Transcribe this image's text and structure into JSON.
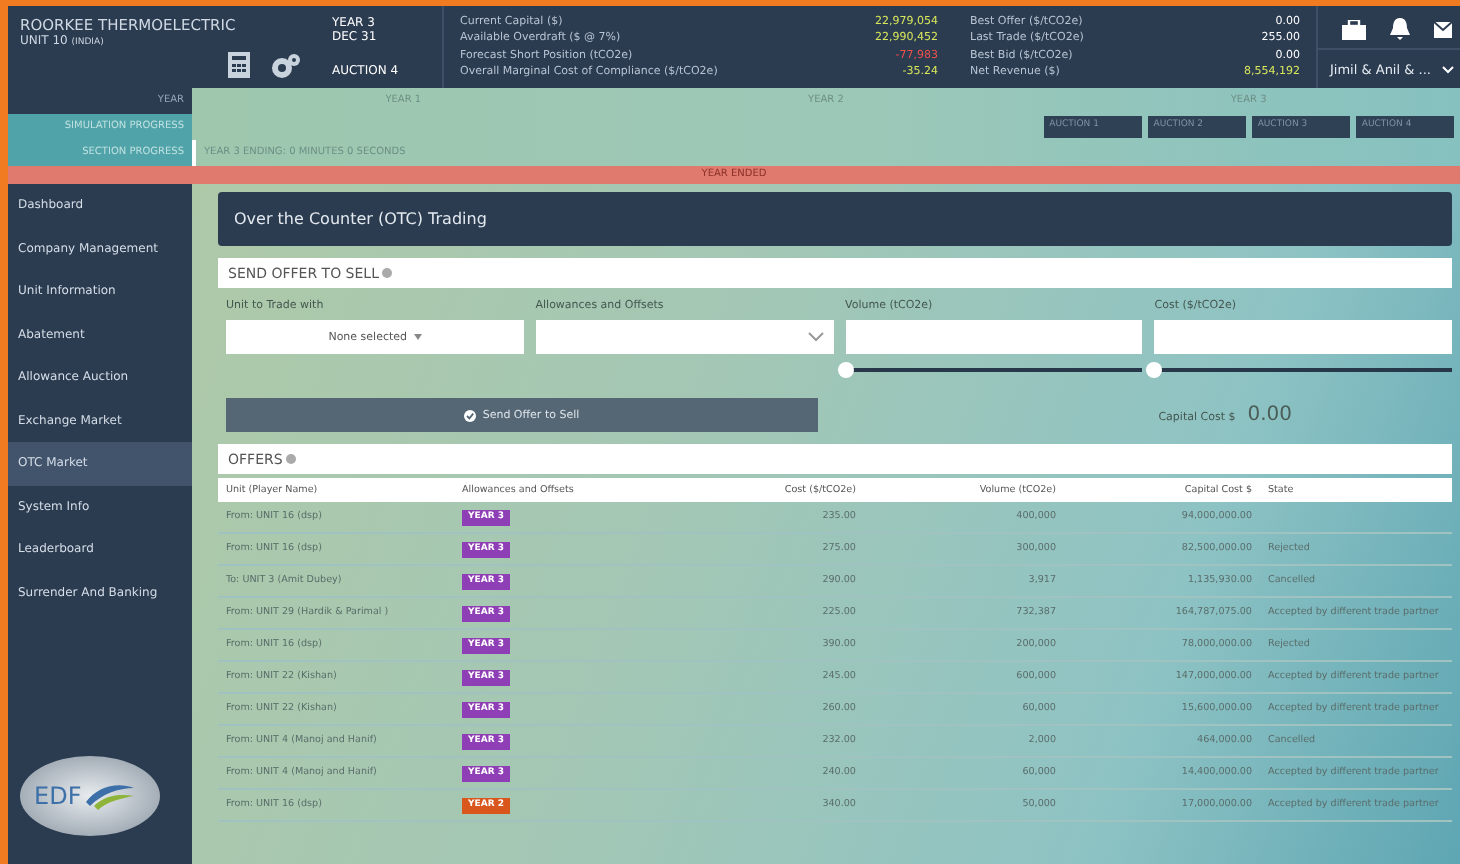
{
  "company": {
    "name": "ROORKEE THERMOELECTRIC",
    "unit": "UNIT 10",
    "region": "(INDIA)"
  },
  "period": {
    "year": "YEAR 3",
    "date": "DEC 31",
    "auction": "AUCTION 4"
  },
  "stats_left": [
    {
      "label": "Current Capital ($)",
      "value": "22,979,054",
      "color": "#d9e85a"
    },
    {
      "label": "Available Overdraft ($ @ 7%)",
      "value": "22,990,452",
      "color": "#d9e85a"
    },
    {
      "label": "Forecast Short Position (tCO2e)",
      "value": "-77,983",
      "color": "#f0524a"
    },
    {
      "label": "Overall Marginal Cost of Compliance ($/tCO2e)",
      "value": "-35.24",
      "color": "#d9e85a"
    }
  ],
  "stats_right": [
    {
      "label": "Best Offer ($/tCO2e)",
      "value": "0.00",
      "color": "#ffffff"
    },
    {
      "label": "Last Trade ($/tCO2e)",
      "value": "255.00",
      "color": "#ffffff"
    },
    {
      "label": "Best Bid ($/tCO2e)",
      "value": "0.00",
      "color": "#ffffff"
    },
    {
      "label": "Net Revenue ($)",
      "value": "8,554,192",
      "color": "#d9e85a"
    }
  ],
  "user_menu": "Jimil & Anil & ...",
  "progress": {
    "year_label": "YEAR",
    "simulation_label": "SIMULATION PROGRESS",
    "section_label": "SECTION PROGRESS",
    "years": [
      {
        "label": "YEAR 1"
      },
      {
        "label": "YEAR 2"
      },
      {
        "label": "YEAR 3",
        "auctions": [
          "AUCTION 1",
          "AUCTION 2",
          "AUCTION 3",
          "AUCTION 4"
        ]
      }
    ],
    "section_text": "YEAR 3 ENDING: 0 MINUTES 0 SECONDS",
    "banner": "YEAR ENDED"
  },
  "sidebar": {
    "items": [
      {
        "label": "Dashboard",
        "selected": false
      },
      {
        "label": "Company Management",
        "selected": false
      },
      {
        "label": "Unit Information",
        "selected": false
      },
      {
        "label": "Abatement",
        "selected": false
      },
      {
        "label": "Allowance Auction",
        "selected": false
      },
      {
        "label": "Exchange Market",
        "selected": false
      },
      {
        "label": "OTC Market",
        "selected": true
      },
      {
        "label": "System Info",
        "selected": false
      },
      {
        "label": "Leaderboard",
        "selected": false
      },
      {
        "label": "Surrender And Banking",
        "selected": false
      }
    ],
    "logo": "EDF"
  },
  "page_title": "Over the Counter (OTC) Trading",
  "offer_form": {
    "title": "SEND OFFER TO SELL",
    "unit": {
      "label": "Unit to Trade with",
      "value": "None selected"
    },
    "allowances": {
      "label": "Allowances and Offsets"
    },
    "volume": {
      "label": "Volume (tCO2e)",
      "level": 0
    },
    "cost": {
      "label": "Cost ($/tCO2e)",
      "level": 0
    },
    "button": "Send Offer to Sell",
    "capital_label": "Capital Cost $",
    "capital_value": "0.00"
  },
  "offers": {
    "title": "OFFERS",
    "columns": [
      "Unit (Player Name)",
      "Allowances and Offsets",
      "Cost ($/tCO2e)",
      "Volume (tCO2e)",
      "Capital Cost $",
      "State"
    ],
    "rows": [
      {
        "unit": "From: UNIT 16 (dsp)",
        "tag": "YEAR 3",
        "color": "#8e3fb5",
        "cost": "235.00",
        "volume": "400,000",
        "capital": "94,000,000.00",
        "state": ""
      },
      {
        "unit": "From: UNIT 16 (dsp)",
        "tag": "YEAR 3",
        "color": "#8e3fb5",
        "cost": "275.00",
        "volume": "300,000",
        "capital": "82,500,000.00",
        "state": "Rejected"
      },
      {
        "unit": "To: UNIT 3 (Amit Dubey)",
        "tag": "YEAR 3",
        "color": "#8e3fb5",
        "cost": "290.00",
        "volume": "3,917",
        "capital": "1,135,930.00",
        "state": "Cancelled"
      },
      {
        "unit": "From: UNIT 29 (Hardik & Parimal )",
        "tag": "YEAR 3",
        "color": "#8e3fb5",
        "cost": "225.00",
        "volume": "732,387",
        "capital": "164,787,075.00",
        "state": "Accepted by different trade partner"
      },
      {
        "unit": "From: UNIT 16 (dsp)",
        "tag": "YEAR 3",
        "color": "#8e3fb5",
        "cost": "390.00",
        "volume": "200,000",
        "capital": "78,000,000.00",
        "state": "Rejected"
      },
      {
        "unit": "From: UNIT 22 (Kishan)",
        "tag": "YEAR 3",
        "color": "#8e3fb5",
        "cost": "245.00",
        "volume": "600,000",
        "capital": "147,000,000.00",
        "state": "Accepted by different trade partner"
      },
      {
        "unit": "From: UNIT 22 (Kishan)",
        "tag": "YEAR 3",
        "color": "#8e3fb5",
        "cost": "260.00",
        "volume": "60,000",
        "capital": "15,600,000.00",
        "state": "Accepted by different trade partner"
      },
      {
        "unit": "From: UNIT 4 (Manoj and Hanif)",
        "tag": "YEAR 3",
        "color": "#8e3fb5",
        "cost": "232.00",
        "volume": "2,000",
        "capital": "464,000.00",
        "state": "Cancelled"
      },
      {
        "unit": "From: UNIT 4 (Manoj and Hanif)",
        "tag": "YEAR 3",
        "color": "#8e3fb5",
        "cost": "240.00",
        "volume": "60,000",
        "capital": "14,400,000.00",
        "state": "Accepted by different trade partner"
      },
      {
        "unit": "From: UNIT 16 (dsp)",
        "tag": "YEAR 2",
        "color": "#d9561c",
        "cost": "340.00",
        "volume": "50,000",
        "capital": "17,000,000.00",
        "state": "Accepted by different trade partner"
      }
    ]
  }
}
